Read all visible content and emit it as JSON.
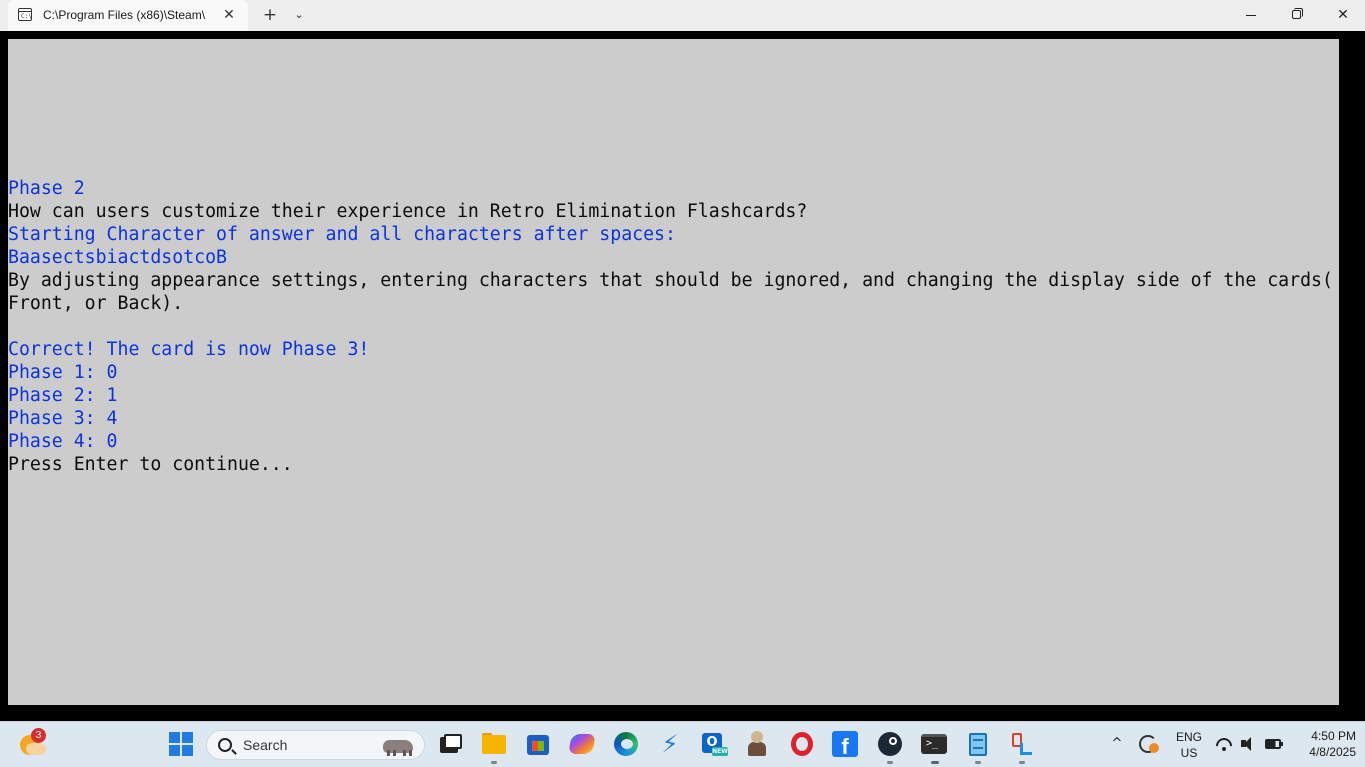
{
  "window": {
    "tab_title": "C:\\Program Files (x86)\\Steam\\",
    "tab_icon_text": "C:\\",
    "close_tab_glyph": "✕",
    "new_tab_glyph": "+",
    "dropdown_glyph": "⌄",
    "close_window_glyph": "✕"
  },
  "console": {
    "lines": [
      {
        "text": "Phase 2",
        "color": "blue"
      },
      {
        "text": "How can users customize their experience in Retro Elimination Flashcards?",
        "color": "black"
      },
      {
        "text": "Starting Character of answer and all characters after spaces:",
        "color": "blue"
      },
      {
        "text": "BaasectsbiactdsotcoB",
        "color": "blue"
      },
      {
        "text": "By adjusting appearance settings, entering characters that should be ignored, and changing the display side of the cards(",
        "color": "black"
      },
      {
        "text": "Front, or Back).",
        "color": "black"
      },
      {
        "text": "",
        "color": "black"
      },
      {
        "text": "Correct! The card is now Phase 3!",
        "color": "blue"
      },
      {
        "text": "Phase 1: 0",
        "color": "blue"
      },
      {
        "text": "Phase 2: 1",
        "color": "blue"
      },
      {
        "text": "Phase 3: 4",
        "color": "blue"
      },
      {
        "text": "Phase 4: 0",
        "color": "blue"
      },
      {
        "text": "Press Enter to continue...",
        "color": "black"
      }
    ],
    "colors": {
      "background": "#cccccc",
      "blue": "#0b33e0",
      "black": "#0c0c0c"
    }
  },
  "taskbar": {
    "weather_badge": "3",
    "search_placeholder": "Search",
    "vscode_glyph": "⚡",
    "outlook_letter": "O",
    "outlook_badge": "NEW",
    "facebook_letter": "f",
    "terminal_prompt": ">_",
    "tray_chevron": "^",
    "language_top": "ENG",
    "language_bottom": "US",
    "time": "4:50 PM",
    "date": "4/8/2025"
  }
}
